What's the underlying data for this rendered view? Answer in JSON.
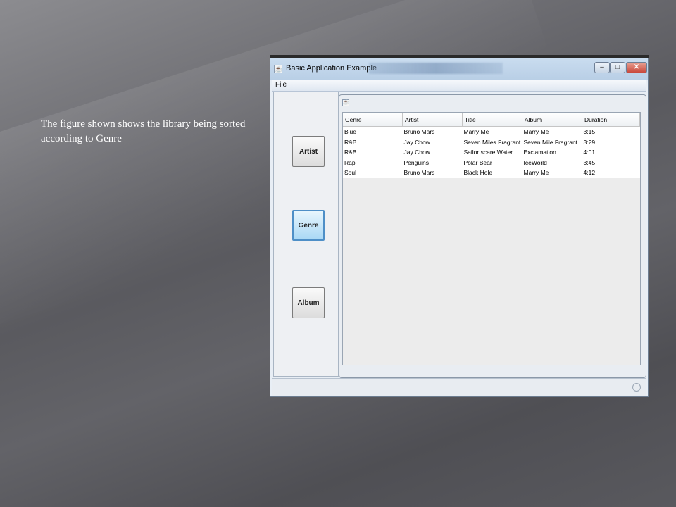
{
  "caption": "The figure shown shows the library being sorted according to Genre",
  "window": {
    "title": "Basic Application Example",
    "controls": {
      "minimize": "–",
      "maximize": "□",
      "close": "✕"
    }
  },
  "menu": {
    "file": "File"
  },
  "nav_buttons": {
    "artist": "Artist",
    "genre": "Genre",
    "album": "Album",
    "active": "Genre"
  },
  "table": {
    "columns": [
      "Genre",
      "Artist",
      "Title",
      "Album",
      "Duration"
    ],
    "rows": [
      [
        "Blue",
        "Bruno Mars",
        "Marry Me",
        "Marry Me",
        "3:15"
      ],
      [
        "R&B",
        "Jay Chow",
        "Seven Miles Fragrant",
        "Seven Mile Fragrant",
        "3:29"
      ],
      [
        "R&B",
        "Jay Chow",
        "Sailor scare Water",
        "Exclamation",
        "4:01"
      ],
      [
        "Rap",
        "Penguins",
        "Polar Bear",
        "IceWorld",
        "3:45"
      ],
      [
        "Soul",
        "Bruno Mars",
        "Black Hole",
        "Marry Me",
        "4:12"
      ]
    ]
  },
  "colors": {
    "active_button": "#a9d8f5",
    "titlebar": "#c9dcef",
    "close_button": "#c9473a"
  }
}
